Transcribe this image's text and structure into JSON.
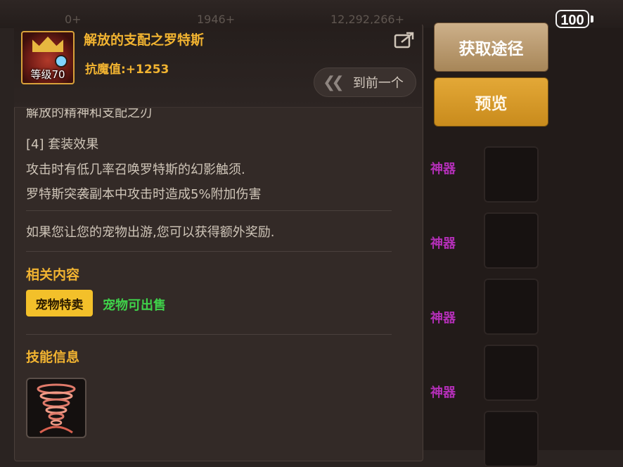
{
  "status": {
    "battery": "100"
  },
  "background": {
    "top_dim_texts": [
      "0+",
      "1946+",
      "12,292,266+"
    ],
    "tags": [
      "神器",
      "神器",
      "神器",
      "神器"
    ]
  },
  "actions": {
    "route_label": "获取途径",
    "preview_label": "预览"
  },
  "item": {
    "name": "解放的支配之罗特斯",
    "level_label": "等级70",
    "stat": "抗魔值:+1253",
    "prev_label": "到前一个"
  },
  "description": {
    "cut_line": "解放的精神和支配之刃",
    "set_effect_header": "[4] 套装效果",
    "set_effect_line1": "攻击时有低几率召唤罗特斯的幻影触须.",
    "set_effect_line2": "罗特斯突袭副本中攻击时造成5%附加伤害",
    "pet_note": "如果您让您的宠物出游,您可以获得额外奖励."
  },
  "related": {
    "title": "相关内容",
    "tag_yellow": "宠物特卖",
    "tag_green": "宠物可出售"
  },
  "skills": {
    "title": "技能信息"
  },
  "colors": {
    "gold_text": "#f2b431",
    "green_text": "#3fd24a",
    "button_route": "#b8966a",
    "button_preview": "#d99a2a",
    "tag_purple": "#b32fb7"
  }
}
